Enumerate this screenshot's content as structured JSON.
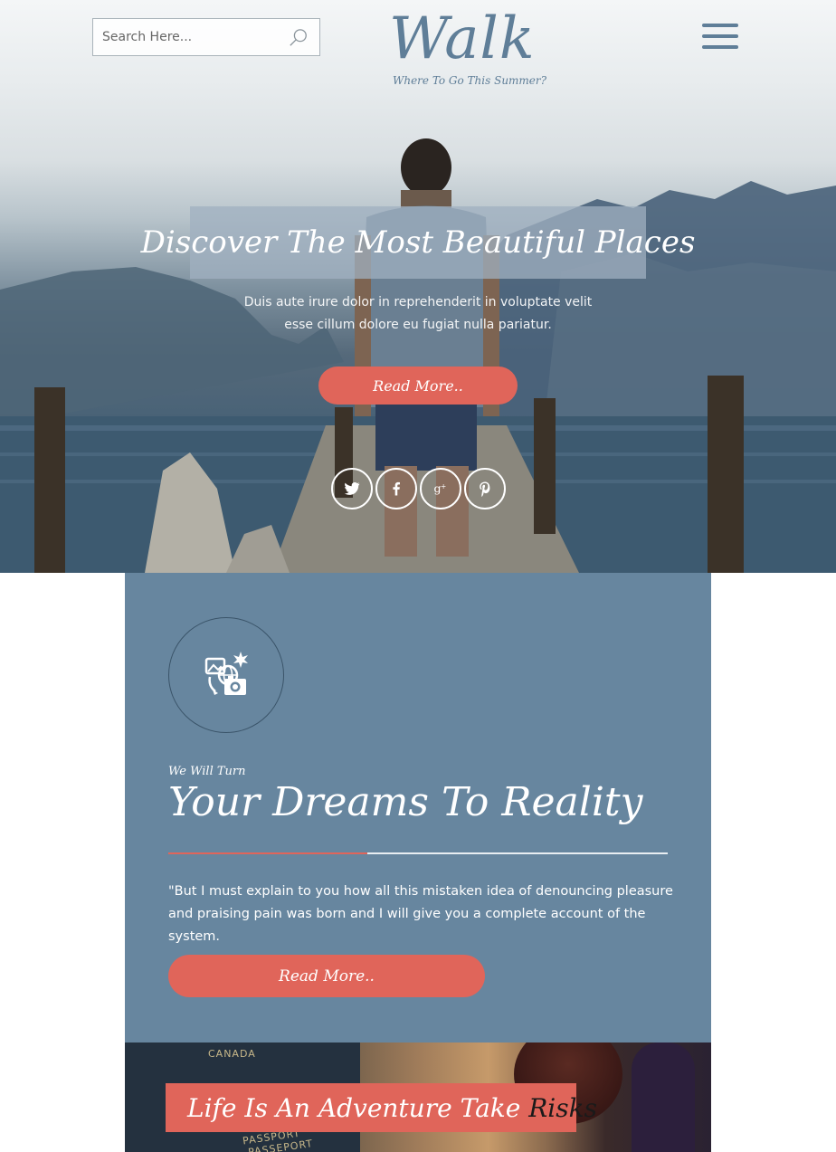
{
  "header": {
    "search": {
      "placeholder": "Search Here...",
      "icon": "search-icon"
    },
    "logo": {
      "title": "Walk",
      "tagline": "Where To Go This Summer?"
    },
    "menu_icon": "hamburger-menu-icon"
  },
  "hero": {
    "title": "Discover The Most Beautiful Places",
    "text": "Duis aute irure dolor in reprehenderit in voluptate velit esse cillum dolore eu fugiat nulla pariatur.",
    "button_label": "Read More..",
    "social": [
      {
        "name": "twitter-icon"
      },
      {
        "name": "facebook-icon"
      },
      {
        "name": "google-plus-icon"
      },
      {
        "name": "pinterest-icon"
      }
    ]
  },
  "feature": {
    "icon": "travel-photo-globe-icon",
    "kicker": "We Will Turn",
    "title": "Your Dreams To Reality",
    "text": "\"But I must explain to you how all this mistaken idea of denouncing pleasure and praising pain was born and I will give you a complete account of the system.",
    "button_label": "Read More..",
    "accent_color": "#e0655a",
    "panel_color": "#67869f"
  },
  "adventure": {
    "title_main": "Life Is An Adventure Take ",
    "title_accent": "Risks",
    "passport_labels": [
      "CANADA",
      "PASSPORT",
      "PASSEPORT"
    ]
  }
}
